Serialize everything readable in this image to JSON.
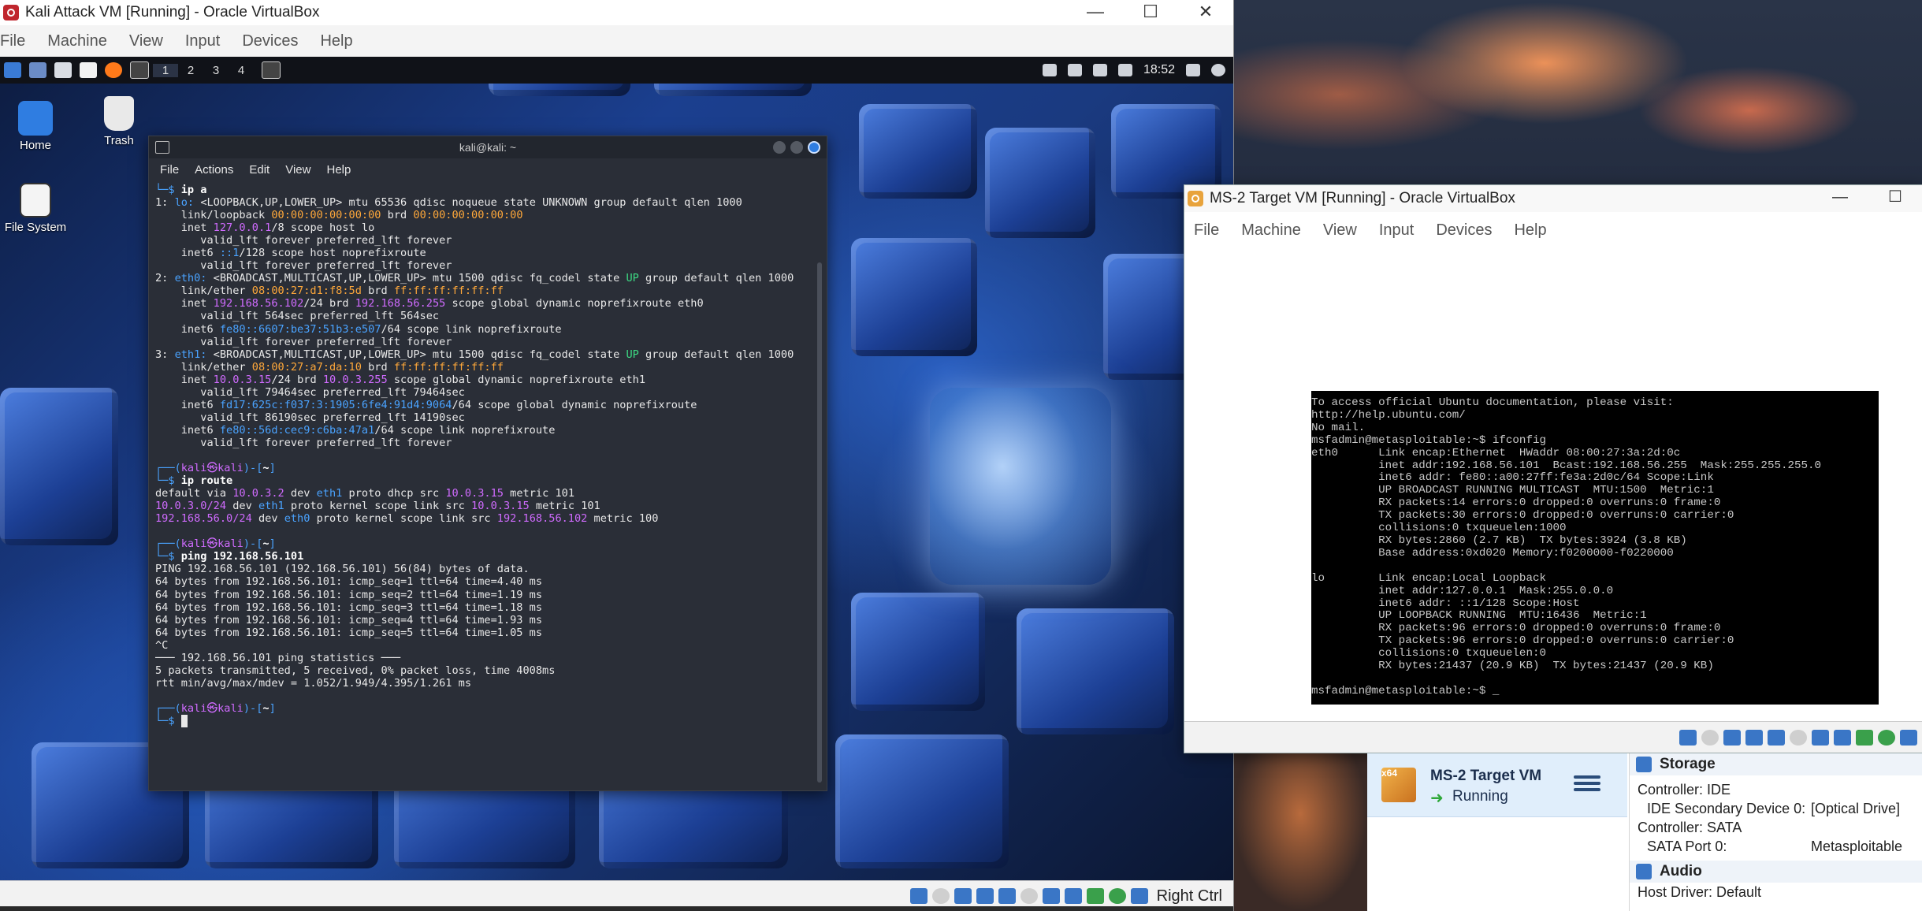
{
  "kali_window": {
    "title": "Kali Attack VM [Running] - Oracle VirtualBox",
    "controls": {
      "minimize": "—",
      "maximize": "☐",
      "close": "✕"
    },
    "menu": [
      "File",
      "Machine",
      "View",
      "Input",
      "Devices",
      "Help"
    ],
    "panel": {
      "workspaces": [
        "1",
        "2",
        "3",
        "4"
      ],
      "clock": "18:52"
    },
    "desktop_icons": {
      "home": "Home",
      "trash": "Trash",
      "filesystem": "File System"
    },
    "terminal": {
      "title": "kali@kali: ~",
      "menu": [
        "File",
        "Actions",
        "Edit",
        "View",
        "Help"
      ]
    },
    "status": {
      "host_key": "Right Ctrl"
    }
  },
  "ms2_window": {
    "title": "MS-2 Target VM [Running] - Oracle VirtualBox",
    "menu": [
      "File",
      "Machine",
      "View",
      "Input",
      "Devices",
      "Help"
    ],
    "console_lines": [
      "To access official Ubuntu documentation, please visit:",
      "http://help.ubuntu.com/",
      "No mail.",
      "msfadmin@metasploitable:~$ ifconfig",
      "eth0      Link encap:Ethernet  HWaddr 08:00:27:3a:2d:0c",
      "          inet addr:192.168.56.101  Bcast:192.168.56.255  Mask:255.255.255.0",
      "          inet6 addr: fe80::a00:27ff:fe3a:2d0c/64 Scope:Link",
      "          UP BROADCAST RUNNING MULTICAST  MTU:1500  Metric:1",
      "          RX packets:14 errors:0 dropped:0 overruns:0 frame:0",
      "          TX packets:30 errors:0 dropped:0 overruns:0 carrier:0",
      "          collisions:0 txqueuelen:1000",
      "          RX bytes:2860 (2.7 KB)  TX bytes:3924 (3.8 KB)",
      "          Base address:0xd020 Memory:f0200000-f0220000",
      "",
      "lo        Link encap:Local Loopback",
      "          inet addr:127.0.0.1  Mask:255.0.0.0",
      "          inet6 addr: ::1/128 Scope:Host",
      "          UP LOOPBACK RUNNING  MTU:16436  Metric:1",
      "          RX packets:96 errors:0 dropped:0 overruns:0 frame:0",
      "          TX packets:96 errors:0 dropped:0 overruns:0 carrier:0",
      "          collisions:0 txqueuelen:0",
      "          RX bytes:21437 (20.9 KB)  TX bytes:21437 (20.9 KB)",
      "",
      "msfadmin@metasploitable:~$ _"
    ]
  },
  "manager": {
    "vm_name": "MS-2 Target VM",
    "vm_state": "Running",
    "os_badge": "x64",
    "storage": {
      "header": "Storage",
      "controller_ide": "Controller: IDE",
      "ide_device_label": "IDE Secondary Device 0:",
      "ide_device_value": "[Optical Drive]",
      "controller_sata": "Controller: SATA",
      "sata_port_label": "SATA Port 0:",
      "sata_port_value": "Metasploitable"
    },
    "audio": {
      "header": "Audio",
      "host_driver": "Host Driver:   Default"
    }
  }
}
